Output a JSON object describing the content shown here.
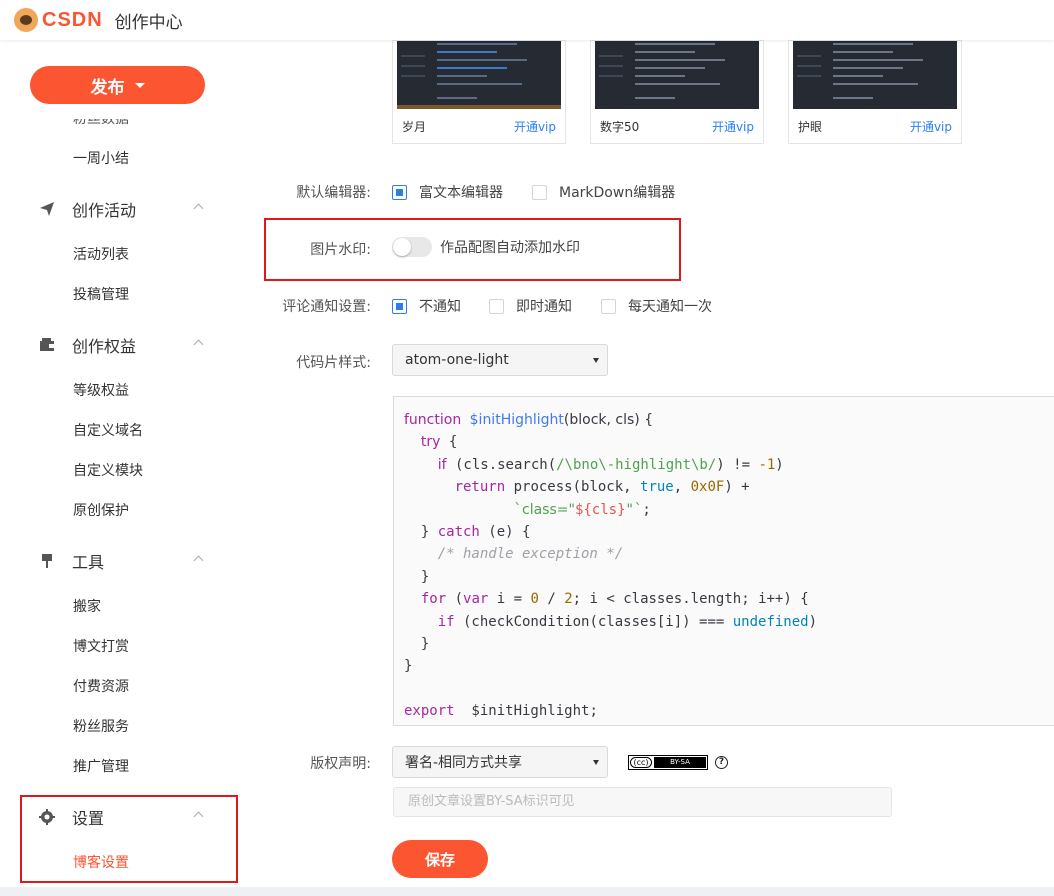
{
  "header": {
    "logo_text": "CSDN",
    "title": "创作中心"
  },
  "sidebar": {
    "publish_label": "发布",
    "clipped_item": "粉丝数据",
    "items_top": [
      {
        "label": "一周小结"
      }
    ],
    "groups": [
      {
        "label": "创作活动",
        "icon": "paper-plane-icon",
        "items": [
          "活动列表",
          "投稿管理"
        ]
      },
      {
        "label": "创作权益",
        "icon": "wallet-icon",
        "items": [
          "等级权益",
          "自定义域名",
          "自定义模块",
          "原创保护"
        ]
      },
      {
        "label": "工具",
        "icon": "tools-icon",
        "items": [
          "搬家",
          "博文打赏",
          "付费资源",
          "粉丝服务",
          "推广管理"
        ]
      },
      {
        "label": "设置",
        "icon": "gear-icon",
        "items": [
          "博客设置"
        ]
      }
    ],
    "active_item": "博客设置",
    "accent_color": "#fc5531"
  },
  "themes": [
    {
      "name": "岁月",
      "vip": "开通vip"
    },
    {
      "name": "数字50",
      "vip": "开通vip"
    },
    {
      "name": "护眼",
      "vip": "开通vip"
    }
  ],
  "settings": {
    "editor": {
      "label": "默认编辑器:",
      "options": [
        {
          "label": "富文本编辑器",
          "checked": true
        },
        {
          "label": "MarkDown编辑器",
          "checked": false
        }
      ]
    },
    "watermark": {
      "label": "图片水印:",
      "toggle_label": "作品配图自动添加水印",
      "enabled": false
    },
    "comment_notify": {
      "label": "评论通知设置:",
      "options": [
        {
          "label": "不通知",
          "checked": true
        },
        {
          "label": "即时通知",
          "checked": false
        },
        {
          "label": "每天通知一次",
          "checked": false
        }
      ]
    },
    "code_style": {
      "label": "代码片样式:",
      "selected": "atom-one-light"
    },
    "copyright": {
      "label": "版权声明:",
      "selected": "署名-相同方式共享",
      "badge_cc": "(cc)",
      "badge_text": "BY-SA",
      "placeholder": "原创文章设置BY-SA标识可见"
    },
    "save_label": "保存"
  }
}
